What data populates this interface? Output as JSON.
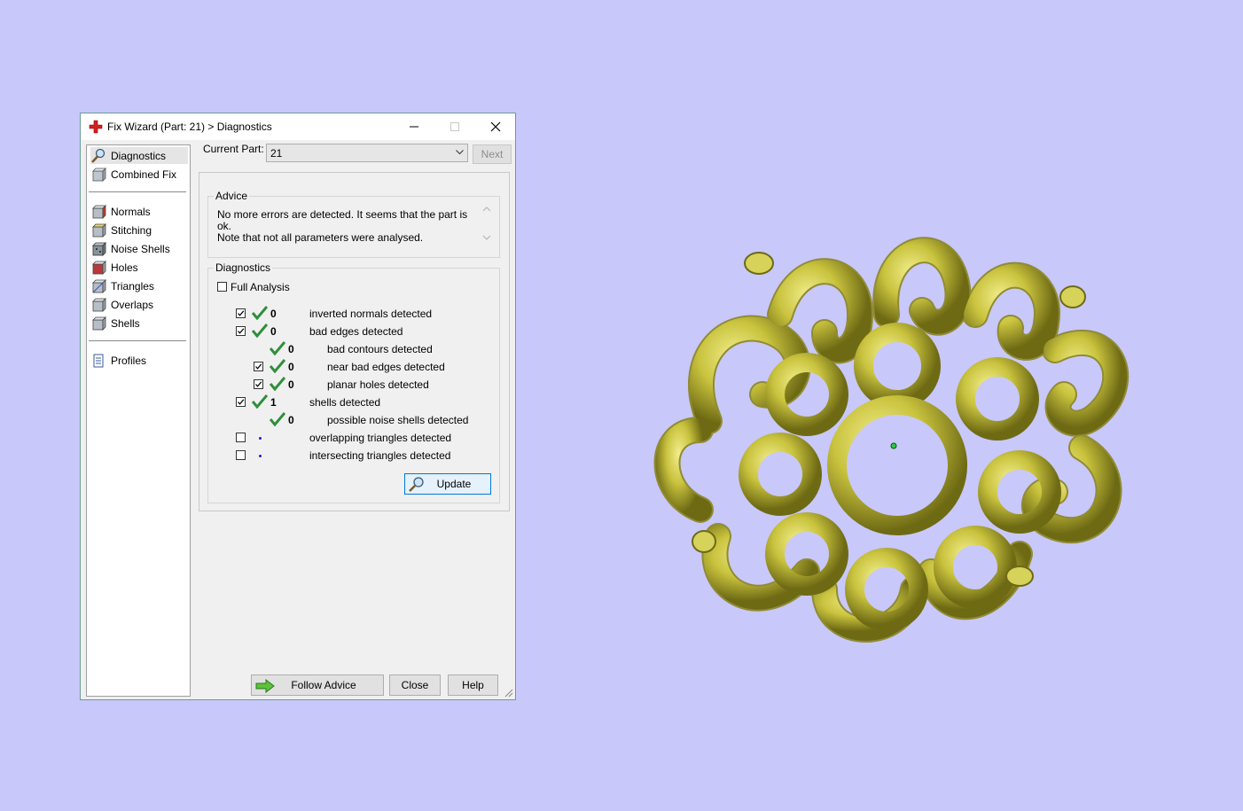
{
  "window": {
    "title": "Fix Wizard (Part: 21) > Diagnostics"
  },
  "sidebar": {
    "items": [
      {
        "label": "Diagnostics",
        "icon": "magnifier-icon",
        "selected": true
      },
      {
        "label": "Combined Fix",
        "icon": "combined-fix-icon"
      },
      {
        "label": "Normals",
        "icon": "normals-cube-icon"
      },
      {
        "label": "Stitching",
        "icon": "stitching-cube-icon"
      },
      {
        "label": "Noise Shells",
        "icon": "noise-shells-cube-icon"
      },
      {
        "label": "Holes",
        "icon": "holes-cube-icon"
      },
      {
        "label": "Triangles",
        "icon": "triangles-cube-icon"
      },
      {
        "label": "Overlaps",
        "icon": "overlaps-cube-icon"
      },
      {
        "label": "Shells",
        "icon": "shells-cube-icon"
      },
      {
        "label": "Profiles",
        "icon": "profiles-document-icon"
      }
    ]
  },
  "current_part": {
    "label": "Current Part:",
    "value": "21",
    "next_label": "Next"
  },
  "advice": {
    "title": "Advice",
    "line1": "No more errors are detected. It seems that the part is ok.",
    "line2": "Note that not all parameters were analysed."
  },
  "diagnostics": {
    "title": "Diagnostics",
    "full_analysis_label": "Full Analysis",
    "full_analysis_checked": false,
    "rows": [
      {
        "checkbox": true,
        "checked": true,
        "status": "ok",
        "count": "0",
        "label": "inverted normals detected",
        "indent": 0
      },
      {
        "checkbox": true,
        "checked": true,
        "status": "ok",
        "count": "0",
        "label": "bad edges detected",
        "indent": 0
      },
      {
        "checkbox": false,
        "checked": false,
        "status": "ok",
        "count": "0",
        "label": "bad contours detected",
        "indent": 1
      },
      {
        "checkbox": true,
        "checked": true,
        "status": "ok",
        "count": "0",
        "label": "near bad edges detected",
        "indent": 1
      },
      {
        "checkbox": true,
        "checked": true,
        "status": "ok",
        "count": "0",
        "label": "planar holes detected",
        "indent": 1
      },
      {
        "checkbox": true,
        "checked": true,
        "status": "ok",
        "count": "1",
        "label": "shells detected",
        "indent": 0
      },
      {
        "checkbox": false,
        "checked": false,
        "status": "ok",
        "count": "0",
        "label": "possible noise shells detected",
        "indent": 1
      },
      {
        "checkbox": true,
        "checked": false,
        "status": "pending",
        "count": "",
        "label": "overlapping triangles detected",
        "indent": 0
      },
      {
        "checkbox": true,
        "checked": false,
        "status": "pending",
        "count": "",
        "label": "intersecting triangles detected",
        "indent": 0
      }
    ],
    "update_label": "Update"
  },
  "footer": {
    "follow_advice_label": "Follow Advice",
    "close_label": "Close",
    "help_label": "Help"
  },
  "colors": {
    "viewport_bg": "#c8c8fa",
    "model_yellow": "#c8c23c",
    "check_green": "#2f8f3a"
  }
}
